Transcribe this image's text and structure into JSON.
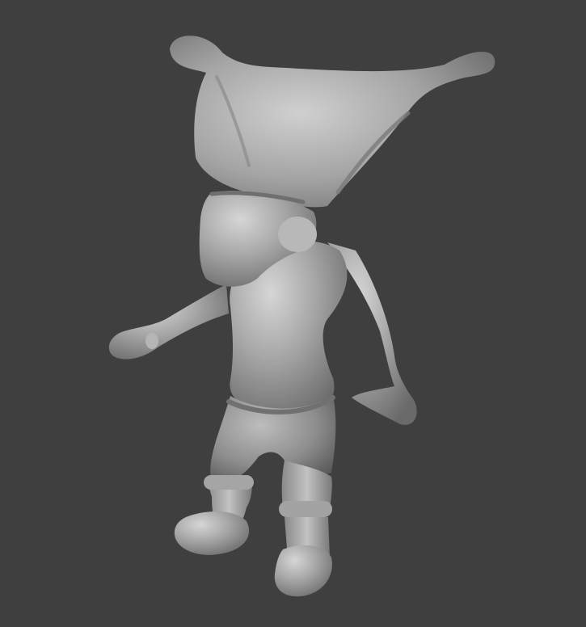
{
  "viewport": {
    "background_color": "#3f3f3f",
    "model_base_color": "#9d9d9d",
    "model_highlight_color": "#d2d2d2",
    "model_shadow_color": "#5c5c5c"
  },
  "model": {
    "name": "sculpted-goblin-character",
    "parts": [
      "hat",
      "head",
      "torso",
      "left-arm",
      "right-arm",
      "shorts",
      "left-leg",
      "right-leg",
      "left-boot",
      "right-boot"
    ]
  }
}
